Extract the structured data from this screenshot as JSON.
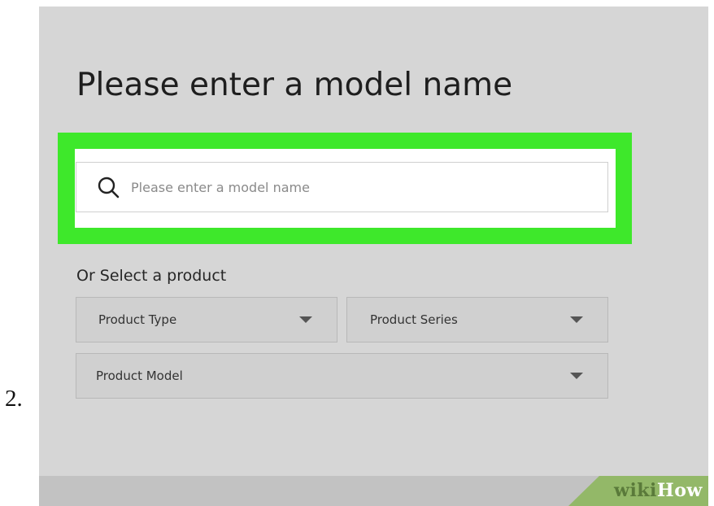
{
  "step": {
    "number": "2."
  },
  "page": {
    "title": "Please enter a model name",
    "search": {
      "placeholder": "Please enter a model name",
      "value": ""
    },
    "subtitle": "Or Select a product",
    "dropdowns": {
      "product_type": "Product Type",
      "product_series": "Product Series",
      "product_model": "Product Model"
    }
  },
  "watermark": {
    "wiki": "wiki",
    "how": "How"
  },
  "colors": {
    "highlight": "#3ee82b",
    "panel_background": "#d6d6d6",
    "watermark_green": "#93b868"
  }
}
